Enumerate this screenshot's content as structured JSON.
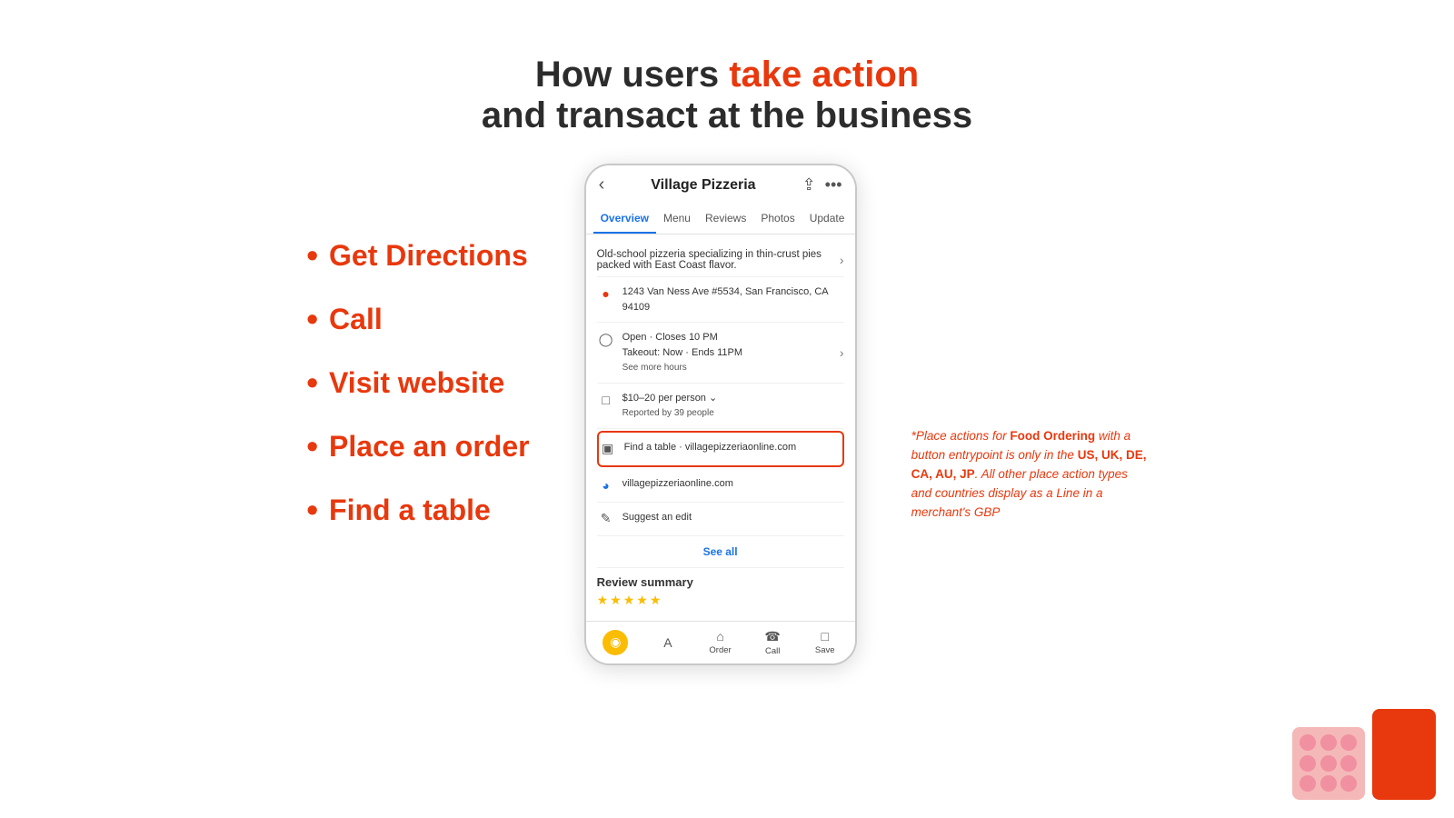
{
  "header": {
    "line1_plain": "How users ",
    "line1_accent": "take action",
    "line2": "and transact at the business"
  },
  "bullet_list": {
    "items": [
      "Get Directions",
      "Call",
      "Visit website",
      "Place an order",
      "Find a table"
    ]
  },
  "phone": {
    "title": "Village Pizzeria",
    "tabs": [
      "Overview",
      "Menu",
      "Reviews",
      "Photos",
      "Update"
    ],
    "active_tab": "Overview",
    "description": "Old-school pizzeria specializing in thin-crust pies packed with East Coast flavor.",
    "address": "1243 Van Ness Ave #5534, San Francisco, CA 94109",
    "hours": "Open · Closes 10 PM",
    "hours_sub": "Takeout: Now · Ends 11PM",
    "see_more_hours": "See more hours",
    "price_range": "$10–20 per person",
    "price_suffix": "✓",
    "price_reported": "Reported by 39 people",
    "find_table": "Find a table · villagepizzeriaonline.com",
    "website": "villagepizzeriaonline.com",
    "suggest_edit": "Suggest an edit",
    "see_all": "See all",
    "review_summary": "Review summary",
    "bottom_nav": {
      "items": [
        "A",
        "Order",
        "Call",
        "Save"
      ]
    }
  },
  "annotation": {
    "text_prefix": "*Place actions for ",
    "bold1": "Food Ordering",
    "text_mid": " with a button entrypoint is only in the ",
    "bold2": "US, UK, DE, CA, AU, JP",
    "text_suffix": ". All other place action types and countries display as a Line in a merchant's GBP"
  }
}
